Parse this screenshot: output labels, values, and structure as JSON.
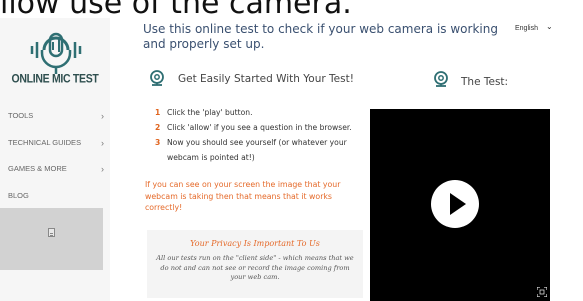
{
  "page": {
    "heading": "llow use of the camera."
  },
  "sidebar": {
    "logo_text": "ONLINE MIC TEST",
    "items": [
      {
        "label": "TOOLS",
        "chevron": "›"
      },
      {
        "label": "TECHNICAL GUIDES",
        "chevron": "›"
      },
      {
        "label": "GAMES & MORE",
        "chevron": "›"
      },
      {
        "label": "BLOG",
        "chevron": ""
      }
    ],
    "ad_icon": "document-icon"
  },
  "header": {
    "intro": "Use this online test to check if your web camera is working and properly set up.",
    "language": "English",
    "language_chevron": "⌄"
  },
  "start_section": {
    "title": "Get Easily Started With Your Test!",
    "steps": [
      {
        "num": "1",
        "text": "Click the 'play' button."
      },
      {
        "num": "2",
        "text": "Click 'allow' if you see a question in the browser."
      },
      {
        "num": "3",
        "text": "Now you should see yourself (or whatever your webcam is pointed at!)"
      }
    ],
    "note": "If you can see on your screen the image that your webcam is taking then that means that it works correctly!"
  },
  "privacy": {
    "title": "Your Privacy Is Important To Us",
    "text": "All our tests run on the \"client side\" - which means that we do not and can not see or record the image coming from your web cam."
  },
  "test_section": {
    "title": "The Test:",
    "play_icon": "play-icon",
    "fullscreen_icon": "fullscreen-icon"
  },
  "colors": {
    "accent_orange": "#e56a2a",
    "icon_teal": "#2f6f73",
    "intro_blue": "#3a5070",
    "video_bg": "#000000"
  }
}
